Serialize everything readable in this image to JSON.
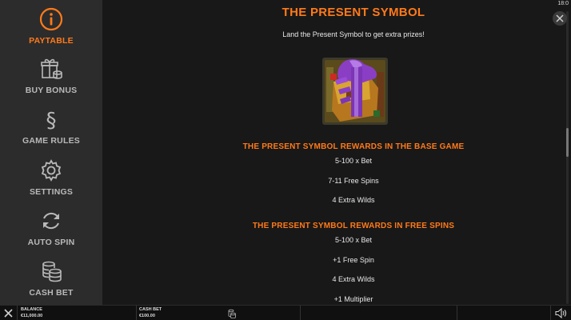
{
  "sidebar": {
    "items": [
      {
        "label": "PAYTABLE",
        "icon": "info-icon",
        "active": true
      },
      {
        "label": "BUY BONUS",
        "icon": "gift-coins-icon",
        "active": false
      },
      {
        "label": "GAME RULES",
        "icon": "section-sign-icon",
        "active": false
      },
      {
        "label": "SETTINGS",
        "icon": "gear-icon",
        "active": false
      },
      {
        "label": "AUTO SPIN",
        "icon": "refresh-icon",
        "active": false
      },
      {
        "label": "CASH BET",
        "icon": "coin-stack-icon",
        "active": false
      }
    ]
  },
  "header": {
    "clock": "18:0"
  },
  "paytable": {
    "title": "THE PRESENT SYMBOL",
    "intro": "Land the Present Symbol to get extra prizes!",
    "symbol_icon": "present-symbol-icon",
    "base_game": {
      "title": "THE PRESENT SYMBOL REWARDS IN THE BASE GAME",
      "rows": [
        "5-100 x Bet",
        "7-11 Free Spins",
        "4 Extra Wilds"
      ]
    },
    "free_spins": {
      "title": "THE PRESENT SYMBOL REWARDS IN FREE SPINS",
      "rows": [
        "5-100 x Bet",
        "+1 Free Spin",
        "4 Extra Wilds",
        "+1 Multiplier"
      ]
    }
  },
  "bottombar": {
    "balance_label": "BALANCE",
    "balance_value": "€11,000.00",
    "cash_bet_label": "CASH BET",
    "cash_bet_value": "€100.00"
  },
  "colors": {
    "accent": "#ff7a1a",
    "sidebar_bg": "#2c2c2c",
    "main_bg": "#181818",
    "menu_label": "#b9b9b9"
  }
}
